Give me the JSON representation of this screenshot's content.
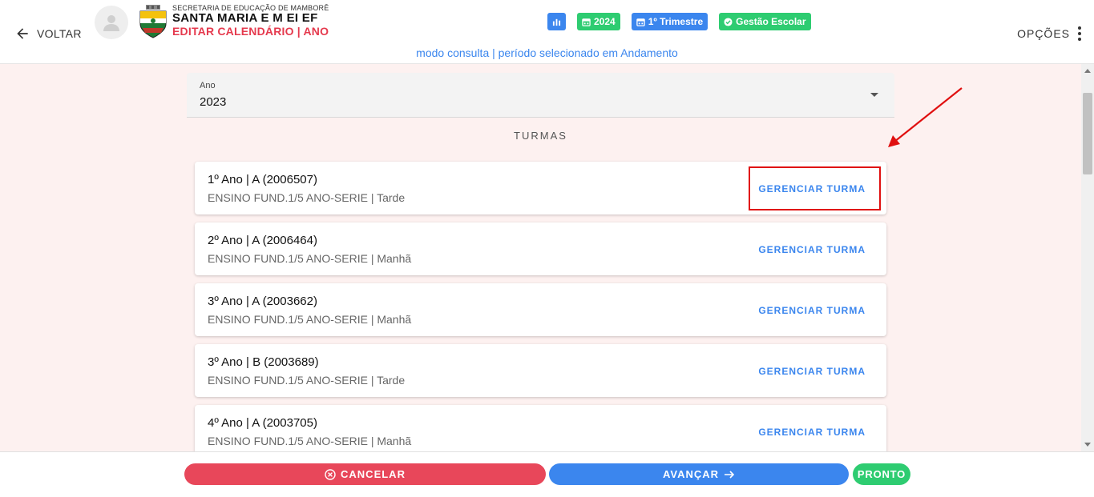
{
  "header": {
    "back_label": "VOLTAR",
    "secretaria": "SECRETARIA DE EDUCAÇÃO DE MAMBORÊ",
    "school_name": "SANTA MARIA E M EI EF",
    "page_title": "EDITAR CALENDÁRIO | ANO",
    "badges": {
      "year": "2024",
      "period": "1º Trimestre",
      "module": "Gestão Escolar"
    },
    "mode_text": "modo consulta | período selecionado em Andamento",
    "options_label": "OPÇÕES"
  },
  "year_select": {
    "label": "Ano",
    "value": "2023"
  },
  "section_title": "TURMAS",
  "turmas": [
    {
      "name": "1º Ano | A (2006507)",
      "info": "ENSINO FUND.1/5 ANO-SERIE | Tarde",
      "action": "GERENCIAR TURMA"
    },
    {
      "name": "2º Ano | A (2006464)",
      "info": "ENSINO FUND.1/5 ANO-SERIE | Manhã",
      "action": "GERENCIAR TURMA"
    },
    {
      "name": "3º Ano | A (2003662)",
      "info": "ENSINO FUND.1/5 ANO-SERIE | Manhã",
      "action": "GERENCIAR TURMA"
    },
    {
      "name": "3º Ano | B (2003689)",
      "info": "ENSINO FUND.1/5 ANO-SERIE | Tarde",
      "action": "GERENCIAR TURMA"
    },
    {
      "name": "4º Ano | A (2003705)",
      "info": "ENSINO FUND.1/5 ANO-SERIE | Manhã",
      "action": "GERENCIAR TURMA"
    }
  ],
  "footer": {
    "cancel_label": "CANCELAR",
    "next_label": "AVANÇAR",
    "done_label": "PRONTO"
  },
  "colors": {
    "primary_blue": "#3b86ee",
    "success_green": "#2ecc71",
    "danger_red": "#e8475a",
    "annotation_red": "#e01010"
  }
}
